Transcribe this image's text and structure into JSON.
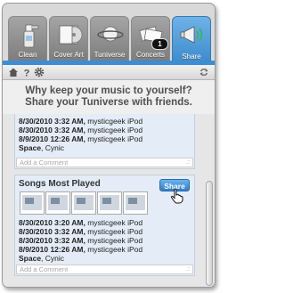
{
  "tabs": [
    {
      "label": "Clean",
      "icon": "spray-bottle-icon"
    },
    {
      "label": "Cover Art",
      "icon": "cover-art-icon"
    },
    {
      "label": "Tuniverse",
      "icon": "planet-icon"
    },
    {
      "label": "Concerts",
      "icon": "tickets-icon",
      "badge": "1"
    },
    {
      "label": "Share",
      "icon": "megaphone-icon",
      "active": true
    }
  ],
  "toolbar": {
    "icons": [
      "home-icon",
      "help-icon",
      "gear-icon",
      "refresh-icon"
    ]
  },
  "message": {
    "line1": "Why keep your music to yourself?",
    "line2": "Share your Tuniverse with friends."
  },
  "card1": {
    "rows": [
      {
        "date": "8/30/2010 3:32 AM,",
        "device": "mysticgeek iPod"
      },
      {
        "date": "8/30/2010 3:32 AM,",
        "device": "mysticgeek iPod"
      },
      {
        "date": "8/9/2010 12:26 AM,",
        "device": "mysticgeek iPod"
      }
    ],
    "tags": {
      "bold": "Space",
      "rest": ", Cynic"
    },
    "comment_placeholder": "Add a Comment"
  },
  "card2": {
    "title": "Songs Most Played",
    "share_label": "Share",
    "rows": [
      {
        "date": "8/30/2010 3:20 AM,",
        "device": "mysticgeek iPod"
      },
      {
        "date": "8/30/2010 3:32 AM,",
        "device": "mysticgeek iPod"
      },
      {
        "date": "8/30/2010 3:32 AM,",
        "device": "mysticgeek iPod"
      },
      {
        "date": "8/9/2010 12:26 AM,",
        "device": "mysticgeek iPod"
      }
    ],
    "tags": {
      "bold": "Space",
      "rest": ", Cynic"
    },
    "comment_placeholder": "Add a Comment"
  },
  "colors": {
    "accent": "#3c8ed3",
    "card_bg": "#e4ecf7"
  }
}
